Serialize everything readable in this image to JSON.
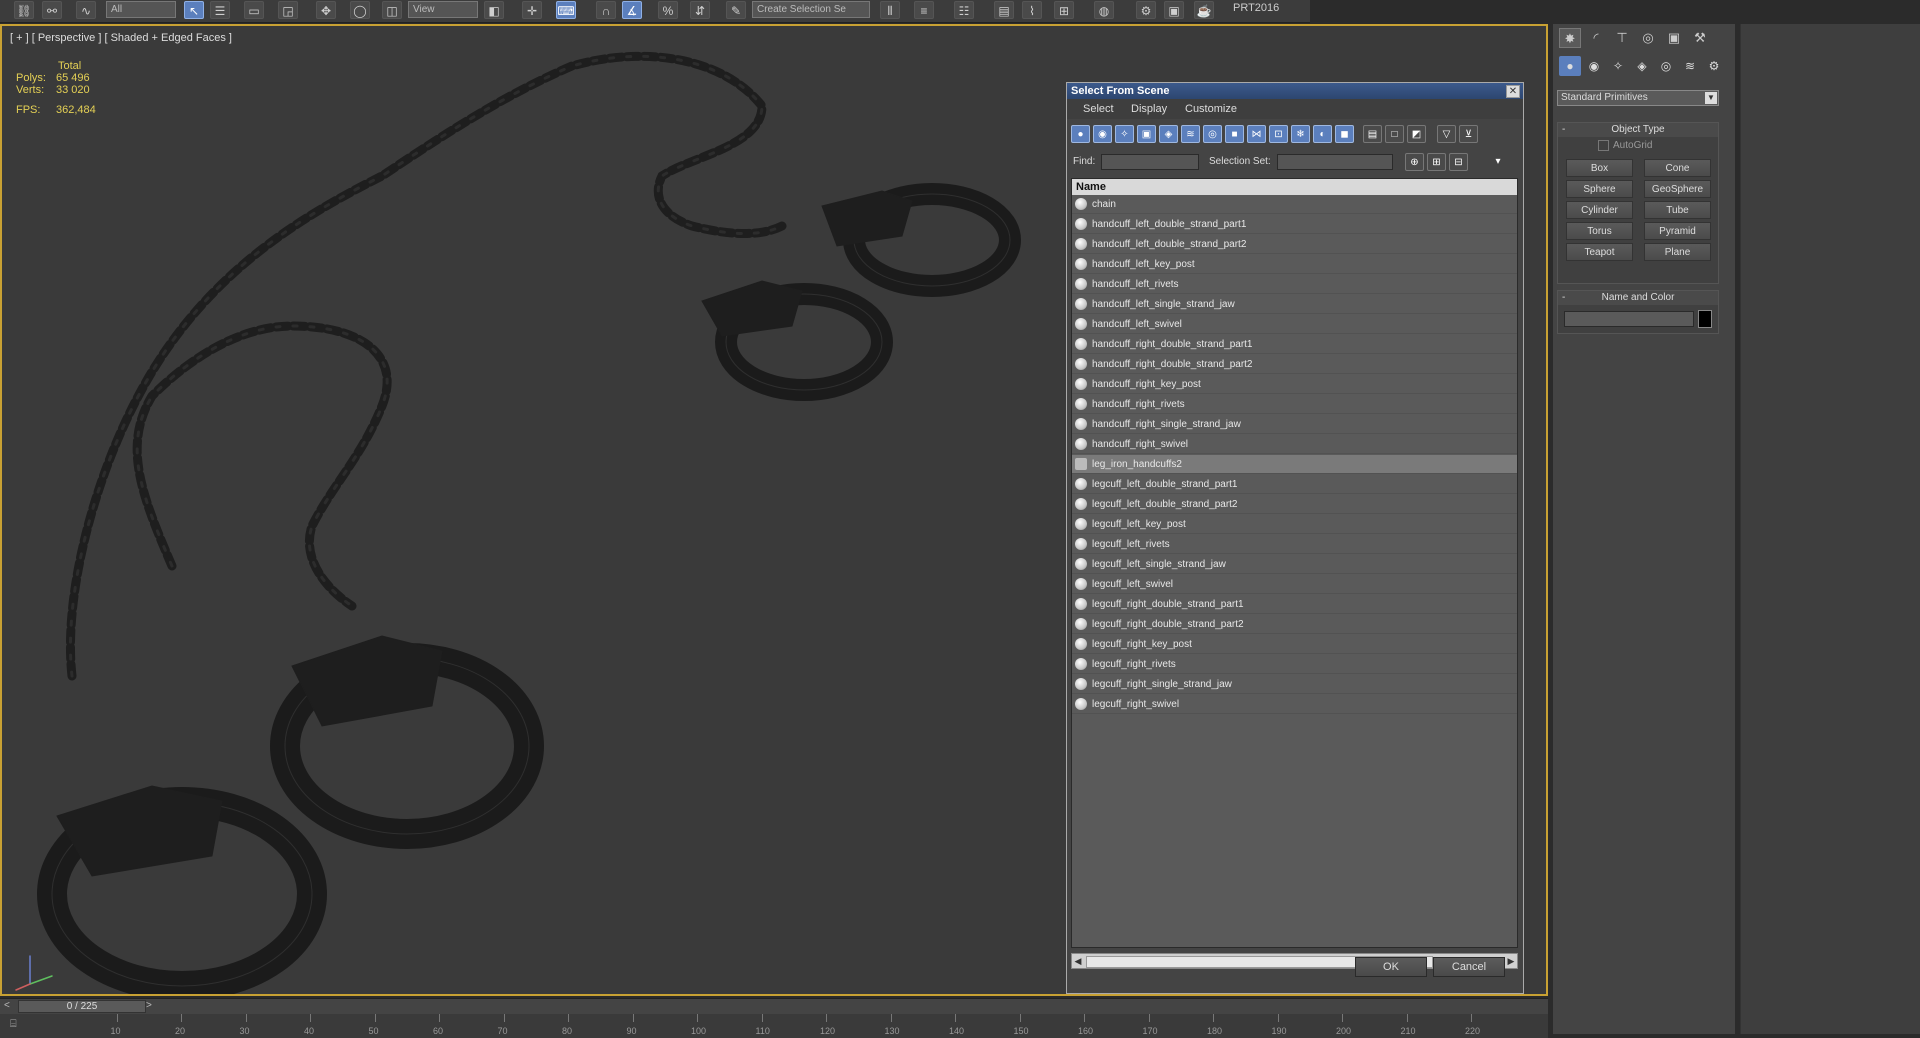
{
  "app": {
    "version_label": "PRT2016",
    "toolbar_dropdowns": [
      "All",
      "View",
      "Create Selection Se"
    ]
  },
  "viewport": {
    "label": "[ + ] [ Perspective ] [ Shaded + Edged Faces ]",
    "stats": {
      "header": "Total",
      "polys_label": "Polys:",
      "polys_value": "65 496",
      "verts_label": "Verts:",
      "verts_value": "33 020",
      "fps_label": "FPS:",
      "fps_value": "362,484"
    }
  },
  "dialog": {
    "title": "Select From Scene",
    "close_icon": "close-icon",
    "menu": [
      "Select",
      "Display",
      "Customize"
    ],
    "find_label": "Find:",
    "find_value": "",
    "selection_set_label": "Selection Set:",
    "selection_set_value": "",
    "list_header": "Name",
    "items": [
      {
        "name": "chain",
        "selected": false
      },
      {
        "name": "handcuff_left_double_strand_part1",
        "selected": false
      },
      {
        "name": "handcuff_left_double_strand_part2",
        "selected": false
      },
      {
        "name": "handcuff_left_key_post",
        "selected": false
      },
      {
        "name": "handcuff_left_rivets",
        "selected": false
      },
      {
        "name": "handcuff_left_single_strand_jaw",
        "selected": false
      },
      {
        "name": "handcuff_left_swivel",
        "selected": false
      },
      {
        "name": "handcuff_right_double_strand_part1",
        "selected": false
      },
      {
        "name": "handcuff_right_double_strand_part2",
        "selected": false
      },
      {
        "name": "handcuff_right_key_post",
        "selected": false
      },
      {
        "name": "handcuff_right_rivets",
        "selected": false
      },
      {
        "name": "handcuff_right_single_strand_jaw",
        "selected": false
      },
      {
        "name": "handcuff_right_swivel",
        "selected": false
      },
      {
        "name": "leg_iron_handcuffs2",
        "selected": true
      },
      {
        "name": "legcuff_left_double_strand_part1",
        "selected": false
      },
      {
        "name": "legcuff_left_double_strand_part2",
        "selected": false
      },
      {
        "name": "legcuff_left_key_post",
        "selected": false
      },
      {
        "name": "legcuff_left_rivets",
        "selected": false
      },
      {
        "name": "legcuff_left_single_strand_jaw",
        "selected": false
      },
      {
        "name": "legcuff_left_swivel",
        "selected": false
      },
      {
        "name": "legcuff_right_double_strand_part1",
        "selected": false
      },
      {
        "name": "legcuff_right_double_strand_part2",
        "selected": false
      },
      {
        "name": "legcuff_right_key_post",
        "selected": false
      },
      {
        "name": "legcuff_right_rivets",
        "selected": false
      },
      {
        "name": "legcuff_right_single_strand_jaw",
        "selected": false
      },
      {
        "name": "legcuff_right_swivel",
        "selected": false
      }
    ],
    "ok_label": "OK",
    "cancel_label": "Cancel"
  },
  "command_panel": {
    "category_dropdown": "Standard Primitives",
    "object_type": {
      "title": "Object Type",
      "collapse_symbol": "-",
      "autogrid_label": "AutoGrid",
      "buttons": [
        "Box",
        "Cone",
        "Sphere",
        "GeoSphere",
        "Cylinder",
        "Tube",
        "Torus",
        "Pyramid",
        "Teapot",
        "Plane"
      ]
    },
    "name_and_color": {
      "title": "Name and Color",
      "collapse_symbol": "-",
      "name_value": "",
      "color": "#000000"
    }
  },
  "timeline": {
    "frame_display": "0 / 225",
    "prev_symbol": "<",
    "next_symbol": ">",
    "ticks": [
      "10",
      "20",
      "30",
      "40",
      "50",
      "60",
      "70",
      "80",
      "90",
      "100",
      "110",
      "120",
      "130",
      "140",
      "150",
      "160",
      "170",
      "180",
      "190",
      "200",
      "210",
      "220"
    ]
  },
  "colors": {
    "viewport_border": "#c8a133",
    "stats_text": "#e4d055",
    "title_bar": "#3c5a8c",
    "accent": "#5b7fbd"
  }
}
